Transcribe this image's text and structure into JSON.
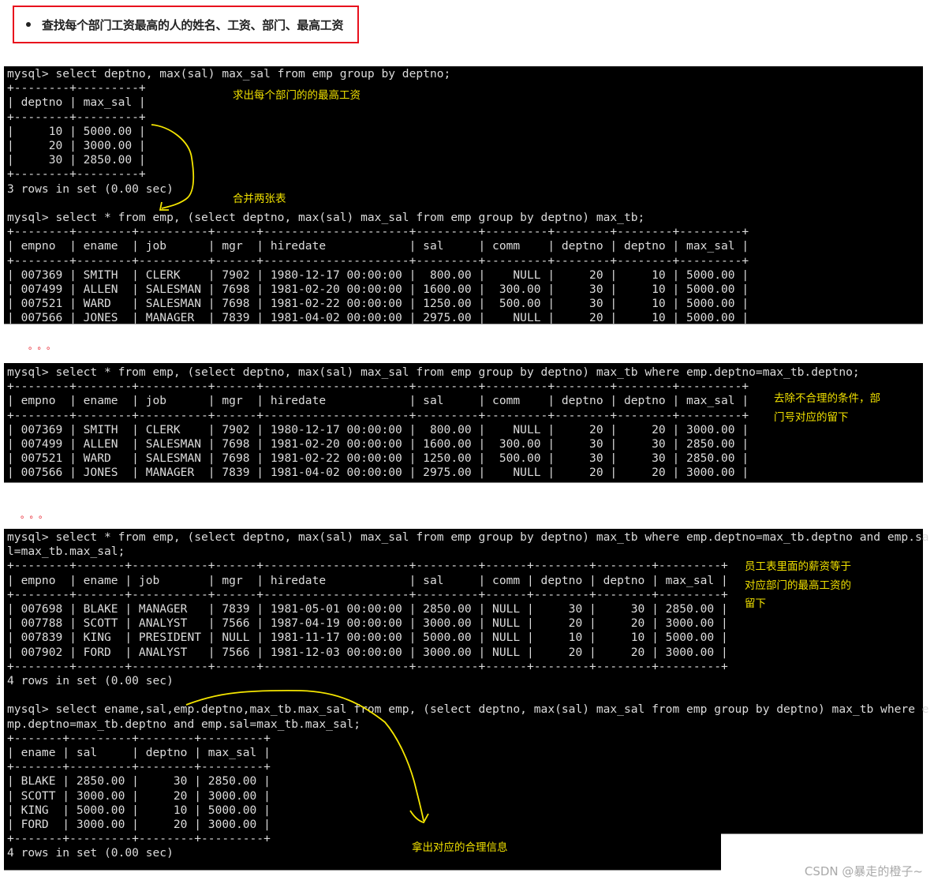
{
  "heading": {
    "bullet_icon": "bullet-dot",
    "text": "查找每个部门工资最高的人的姓名、工资、部门、最高工资",
    "border_color": "#e8101d"
  },
  "terminal1": {
    "lines": [
      "mysql> select deptno, max(sal) max_sal from emp group by deptno;",
      "+--------+---------+",
      "| deptno | max_sal |",
      "+--------+---------+",
      "|     10 | 5000.00 |",
      "|     20 | 3000.00 |",
      "|     30 | 2850.00 |",
      "+--------+---------+",
      "3 rows in set (0.00 sec)",
      "",
      "mysql> select * from emp, (select deptno, max(sal) max_sal from emp group by deptno) max_tb;",
      "+--------+--------+----------+------+---------------------+---------+---------+--------+--------+---------+",
      "| empno  | ename  | job      | mgr  | hiredate            | sal     | comm    | deptno | deptno | max_sal |",
      "+--------+--------+----------+------+---------------------+---------+---------+--------+--------+---------+",
      "| 007369 | SMITH  | CLERK    | 7902 | 1980-12-17 00:00:00 |  800.00 |    NULL |     20 |     10 | 5000.00 |",
      "| 007499 | ALLEN  | SALESMAN | 7698 | 1981-02-20 00:00:00 | 1600.00 |  300.00 |     30 |     10 | 5000.00 |",
      "| 007521 | WARD   | SALESMAN | 7698 | 1981-02-22 00:00:00 | 1250.00 |  500.00 |     30 |     10 | 5000.00 |",
      "| 007566 | JONES  | MANAGER  | 7839 | 1981-04-02 00:00:00 | 2975.00 |    NULL |     20 |     10 | 5000.00 |"
    ],
    "notes": [
      "求出每个部门的的最高工资",
      "合并两张表"
    ]
  },
  "ellipsis": "。。。",
  "terminal2": {
    "lines": [
      "mysql> select * from emp, (select deptno, max(sal) max_sal from emp group by deptno) max_tb where emp.deptno=max_tb.deptno;",
      "+--------+--------+----------+------+---------------------+---------+---------+--------+--------+---------+",
      "| empno  | ename  | job      | mgr  | hiredate            | sal     | comm    | deptno | deptno | max_sal |",
      "+--------+--------+----------+------+---------------------+---------+---------+--------+--------+---------+",
      "| 007369 | SMITH  | CLERK    | 7902 | 1980-12-17 00:00:00 |  800.00 |    NULL |     20 |     20 | 3000.00 |",
      "| 007499 | ALLEN  | SALESMAN | 7698 | 1981-02-20 00:00:00 | 1600.00 |  300.00 |     30 |     30 | 2850.00 |",
      "| 007521 | WARD   | SALESMAN | 7698 | 1981-02-22 00:00:00 | 1250.00 |  500.00 |     30 |     30 | 2850.00 |",
      "| 007566 | JONES  | MANAGER  | 7839 | 1981-04-02 00:00:00 | 2975.00 |    NULL |     20 |     20 | 3000.00 |"
    ],
    "notes": [
      "去除不合理的条件，部",
      "门号对应的留下"
    ]
  },
  "terminal3": {
    "lines": [
      "mysql> select * from emp, (select deptno, max(sal) max_sal from emp group by deptno) max_tb where emp.deptno=max_tb.deptno and emp.sa",
      "l=max_tb.max_sal;",
      "+--------+-------+-----------+------+---------------------+---------+------+--------+--------+---------+",
      "| empno  | ename | job       | mgr  | hiredate            | sal     | comm | deptno | deptno | max_sal |",
      "+--------+-------+-----------+------+---------------------+---------+------+--------+--------+---------+",
      "| 007698 | BLAKE | MANAGER   | 7839 | 1981-05-01 00:00:00 | 2850.00 | NULL |     30 |     30 | 2850.00 |",
      "| 007788 | SCOTT | ANALYST   | 7566 | 1987-04-19 00:00:00 | 3000.00 | NULL |     20 |     20 | 3000.00 |",
      "| 007839 | KING  | PRESIDENT | NULL | 1981-11-17 00:00:00 | 5000.00 | NULL |     10 |     10 | 5000.00 |",
      "| 007902 | FORD  | ANALYST   | 7566 | 1981-12-03 00:00:00 | 3000.00 | NULL |     20 |     20 | 3000.00 |",
      "+--------+-------+-----------+------+---------------------+---------+------+--------+--------+---------+",
      "4 rows in set (0.00 sec)",
      "",
      "mysql> select ename,sal,emp.deptno,max_tb.max_sal from emp, (select deptno, max(sal) max_sal from emp group by deptno) max_tb where e",
      "mp.deptno=max_tb.deptno and emp.sal=max_tb.max_sal;",
      "+-------+---------+--------+---------+",
      "| ename | sal     | deptno | max_sal |",
      "+-------+---------+--------+---------+",
      "| BLAKE | 2850.00 |     30 | 2850.00 |",
      "| SCOTT | 3000.00 |     20 | 3000.00 |",
      "| KING  | 5000.00 |     10 | 5000.00 |",
      "| FORD  | 3000.00 |     20 | 3000.00 |",
      "+-------+---------+--------+---------+",
      "4 rows in set (0.00 sec)"
    ],
    "notes": [
      "员工表里面的薪资等于",
      "对应部门的最高工资的",
      "留下",
      "拿出对应的合理信息"
    ]
  },
  "annotation_color": "#f0e000",
  "watermark": "CSDN @暴走的橙子~"
}
